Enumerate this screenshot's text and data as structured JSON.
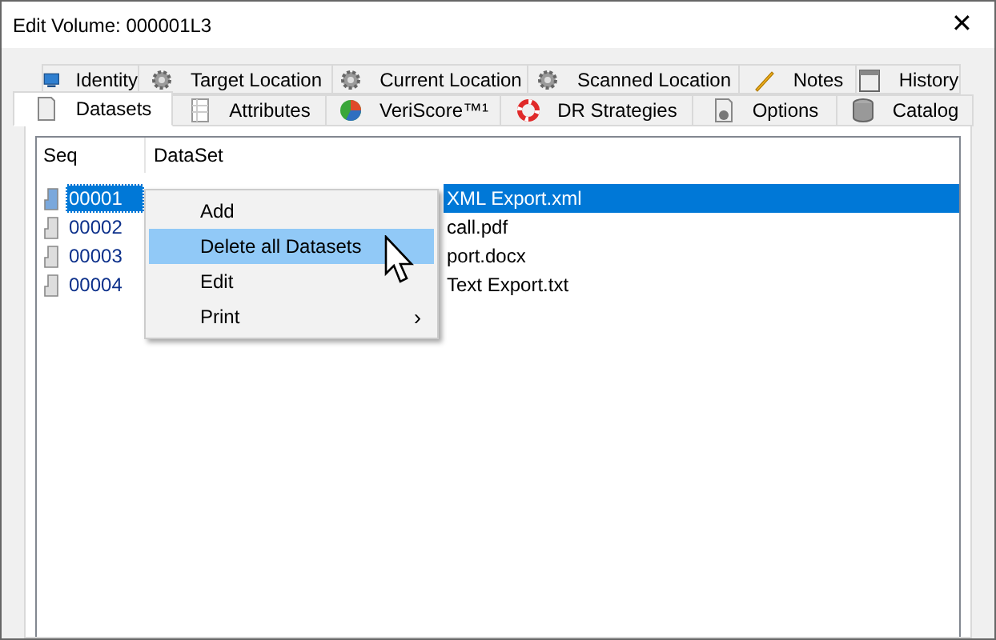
{
  "window": {
    "title": "Edit Volume: 000001L3",
    "close": "✕"
  },
  "tab_rows": [
    [
      {
        "label": "Identity",
        "selected": false
      },
      {
        "label": "Target Location",
        "selected": false
      },
      {
        "label": "Current Location",
        "selected": false
      },
      {
        "label": "Scanned Location",
        "selected": false
      },
      {
        "label": "Notes",
        "selected": false
      },
      {
        "label": "History",
        "selected": false
      }
    ],
    [
      {
        "label": "Datasets",
        "selected": true
      },
      {
        "label": "Attributes",
        "selected": false
      },
      {
        "label": "VeriScore™¹",
        "selected": false
      },
      {
        "label": "DR Strategies",
        "selected": false
      },
      {
        "label": "Options",
        "selected": false
      },
      {
        "label": "Catalog",
        "selected": false
      }
    ]
  ],
  "table": {
    "columns": [
      "Seq",
      "DataSet"
    ],
    "rows": [
      {
        "seq": "00001",
        "dataset": "XML Export.xml",
        "selected": true
      },
      {
        "seq": "00002",
        "dataset": "call.pdf",
        "selected": false
      },
      {
        "seq": "00003",
        "dataset": "port.docx",
        "selected": false
      },
      {
        "seq": "00004",
        "dataset": "Text Export.txt",
        "selected": false
      }
    ]
  },
  "context_menu": {
    "items": [
      {
        "label": "Add",
        "selected": false
      },
      {
        "label": "Delete all Datasets",
        "selected": true
      },
      {
        "label": "Edit",
        "selected": false
      },
      {
        "label": "Print",
        "selected": false,
        "arrow": "›"
      }
    ]
  }
}
